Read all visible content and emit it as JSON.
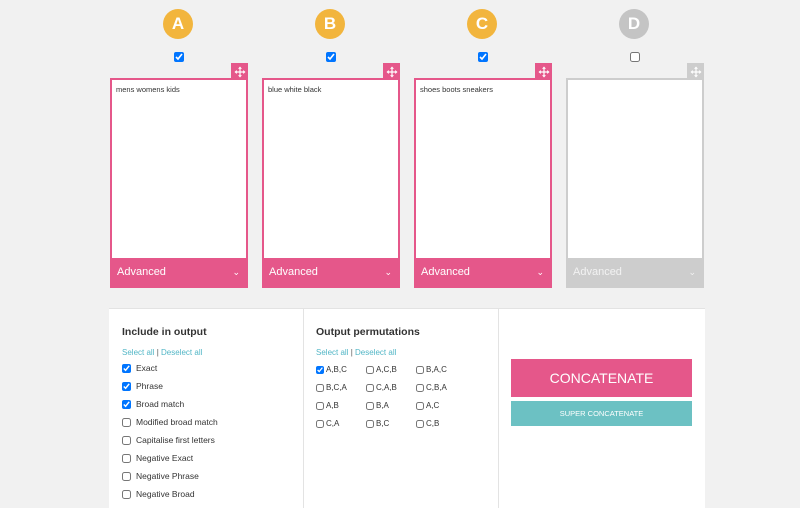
{
  "columns": [
    {
      "letter": "A",
      "checked": true,
      "text": "mens womens kids",
      "advanced_label": "Advanced",
      "active": true
    },
    {
      "letter": "B",
      "checked": true,
      "text": "blue white black",
      "advanced_label": "Advanced",
      "active": true
    },
    {
      "letter": "C",
      "checked": true,
      "text": "shoes boots sneakers",
      "advanced_label": "Advanced",
      "active": true
    },
    {
      "letter": "D",
      "checked": false,
      "text": "",
      "advanced_label": "Advanced",
      "active": false
    }
  ],
  "output": {
    "title": "Include in output",
    "select_all": "Select all",
    "deselect_all": "Deselect all",
    "options": [
      {
        "label": "Exact",
        "checked": true
      },
      {
        "label": "Phrase",
        "checked": true
      },
      {
        "label": "Broad match",
        "checked": true
      },
      {
        "label": "Modified broad match",
        "checked": false
      },
      {
        "label": "Capitalise first letters",
        "checked": false
      },
      {
        "label": "Negative Exact",
        "checked": false
      },
      {
        "label": "Negative Phrase",
        "checked": false
      },
      {
        "label": "Negative Broad",
        "checked": false
      }
    ]
  },
  "permutations": {
    "title": "Output permutations",
    "select_all": "Select all",
    "deselect_all": "Deselect all",
    "rows": [
      [
        {
          "label": "A,B,C",
          "checked": true
        },
        {
          "label": "A,C,B",
          "checked": false
        },
        {
          "label": "B,A,C",
          "checked": false
        }
      ],
      [
        {
          "label": "B,C,A",
          "checked": false
        },
        {
          "label": "C,A,B",
          "checked": false
        },
        {
          "label": "C,B,A",
          "checked": false
        }
      ],
      [
        {
          "label": "A,B",
          "checked": false
        },
        {
          "label": "B,A",
          "checked": false
        },
        {
          "label": "A,C",
          "checked": false
        }
      ],
      [
        {
          "label": "C,A",
          "checked": false
        },
        {
          "label": "B,C",
          "checked": false
        },
        {
          "label": "C,B",
          "checked": false
        }
      ]
    ]
  },
  "actions": {
    "concatenate_label": "CONCATENATE",
    "super_label": "SUPER CONCATENATE"
  },
  "colors": {
    "accent_pink": "#e5578a",
    "accent_teal": "#6cc1c3",
    "badge_yellow": "#f2b53d",
    "inactive_gray": "#cdcdcd"
  }
}
